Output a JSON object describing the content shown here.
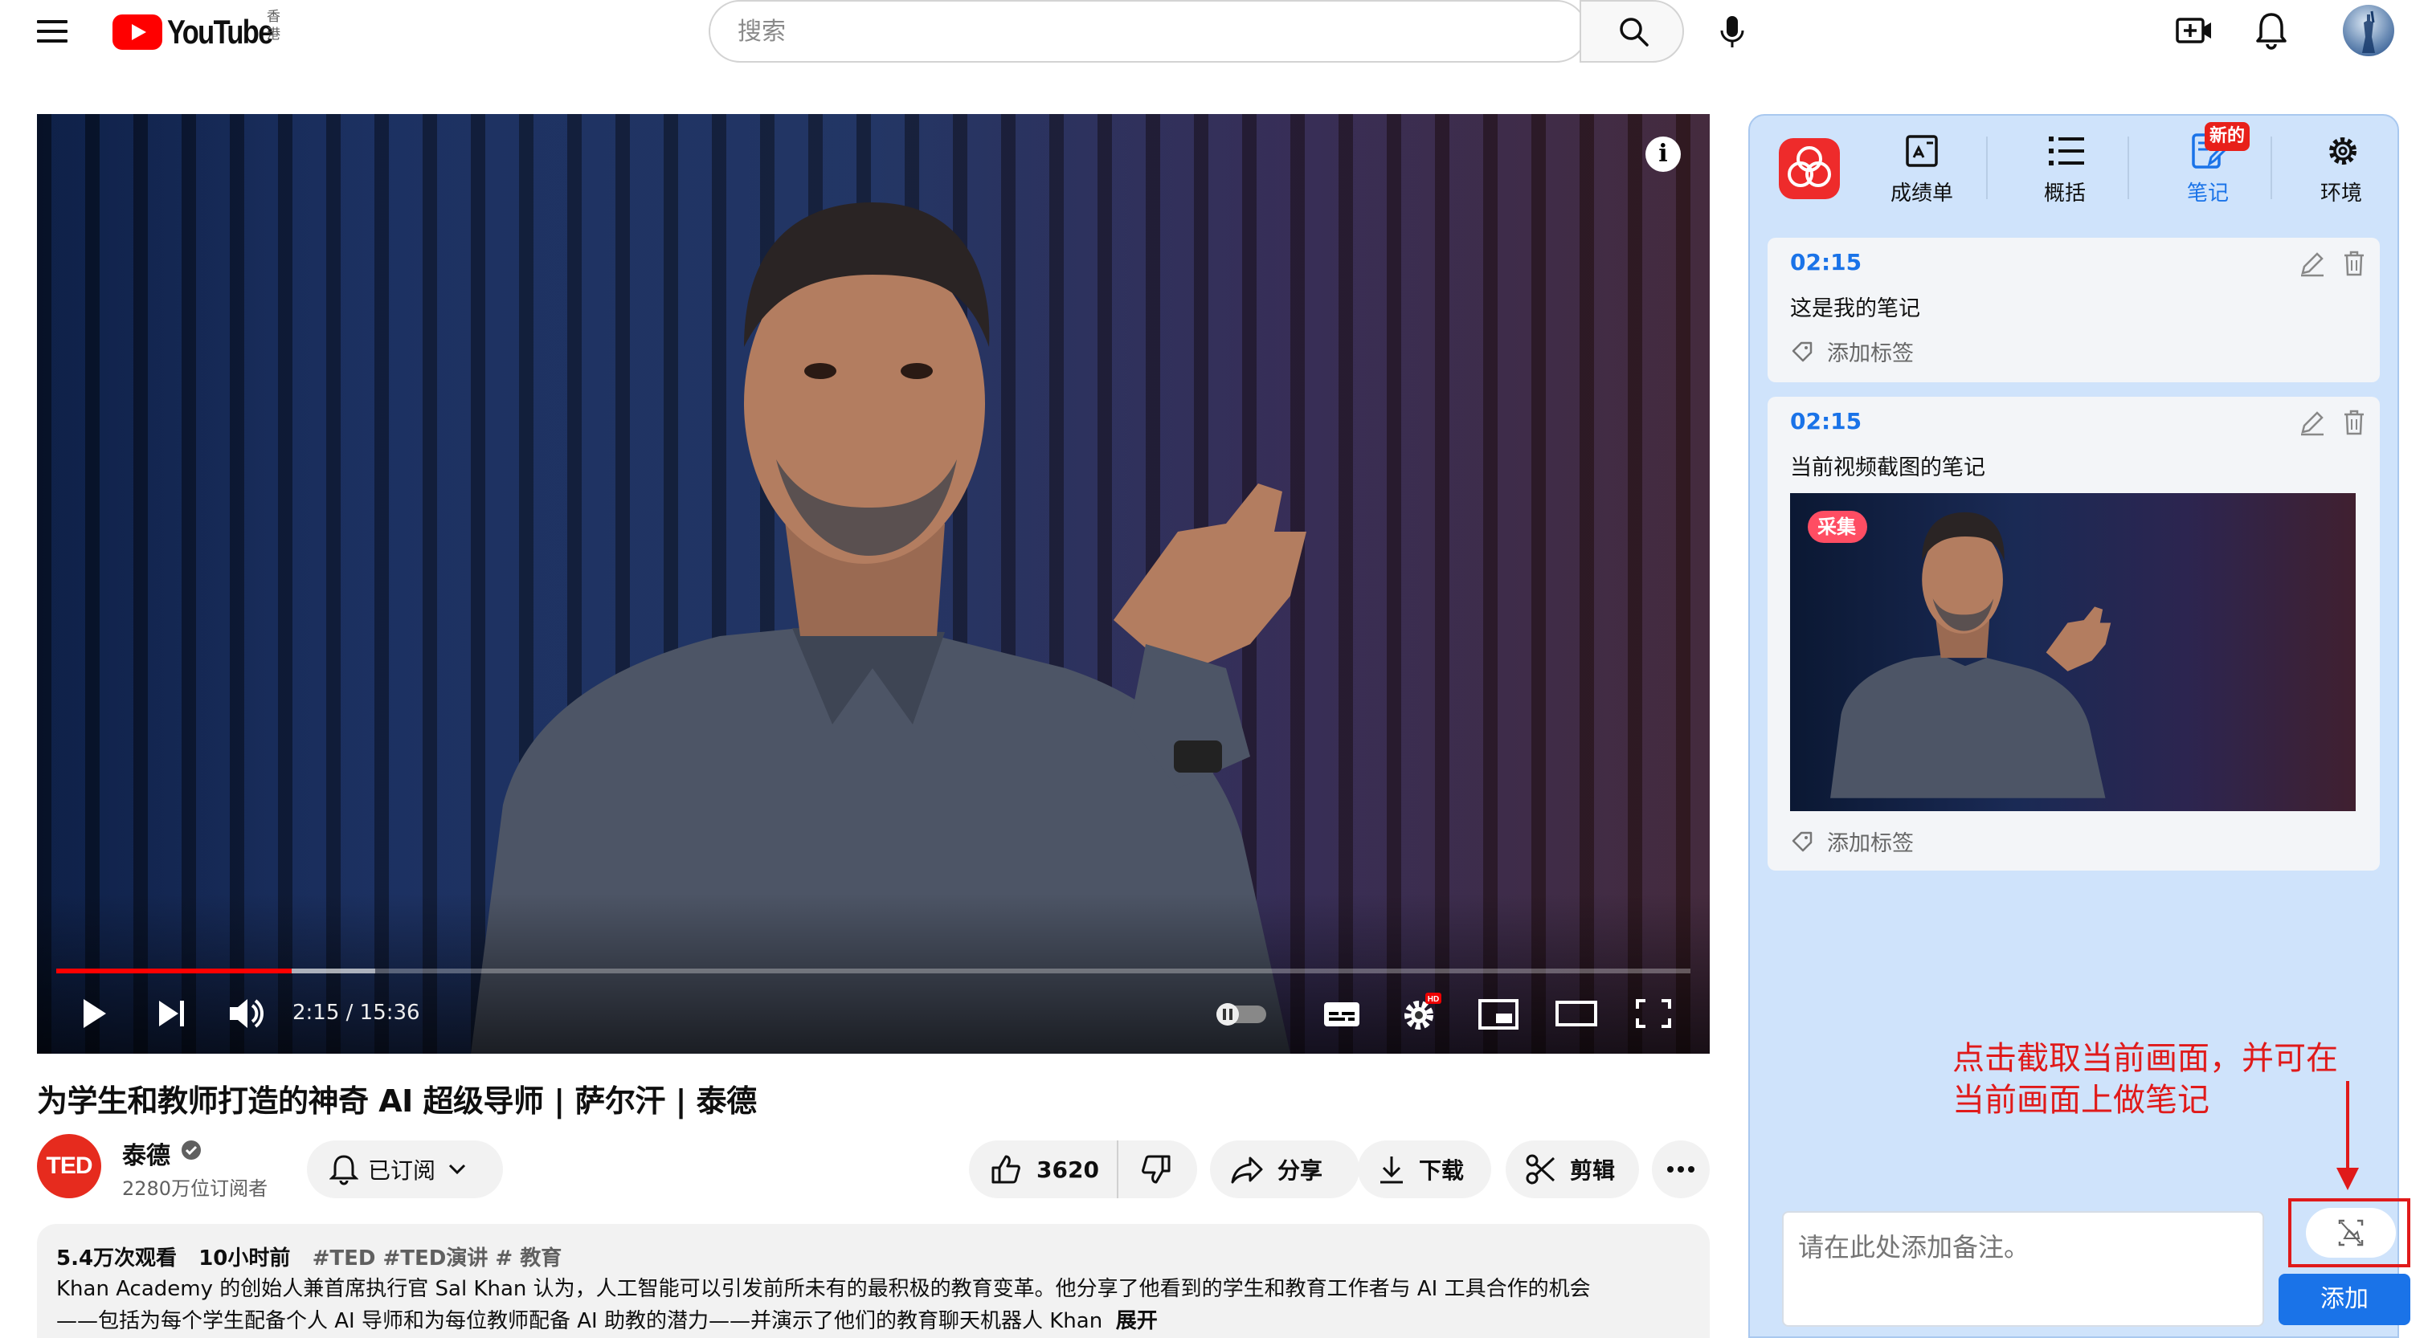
{
  "header": {
    "logo_text": "YouTube",
    "region": "香港",
    "search_placeholder": "搜索",
    "icons": [
      "menu-icon",
      "search-icon",
      "microphone-icon",
      "create-video-icon",
      "bell-icon",
      "avatar"
    ]
  },
  "player": {
    "current_time": "2:15",
    "duration": "15:36",
    "time_display": "2:15 / 15:36",
    "progress_fraction": 0.144,
    "buffered_fraction": 0.195,
    "quality_badge": "HD"
  },
  "video": {
    "title": "为学生和教师打造的神奇 AI 超级导师 | 萨尔汗 | 泰德",
    "channel_logo_text": "TED",
    "channel_name": "泰德",
    "subscribers": "2280万位订阅者",
    "subscribed_label": "已订阅",
    "like_count": "3620",
    "share_label": "分享",
    "download_label": "下载",
    "clip_label": "剪辑"
  },
  "description": {
    "views": "5.4万次观看",
    "age": "10小时前",
    "tags": "#TED #TED演讲 # 教育",
    "line1": "Khan Academy 的创始人兼首席执行官 Sal Khan 认为，人工智能可以引发前所未有的最积极的教育变革。他分享了他看到的学生和教育工作者与 AI 工具合作的机会",
    "line2": "——包括为每个学生配备个人 AI 导师和为每位教师配备 AI 助教的潜力——并演示了他们的教育聊天机器人 Khan",
    "more_label": "展开"
  },
  "panel": {
    "tabs": [
      {
        "label": "成绩单",
        "icon": "transcript-icon"
      },
      {
        "label": "概括",
        "icon": "summary-list-icon"
      },
      {
        "label": "笔记",
        "icon": "notes-icon"
      },
      {
        "label": "环境",
        "icon": "settings-gear-icon"
      }
    ],
    "active_tab": "笔记",
    "new_badge": "新的",
    "notes": [
      {
        "time": "02:15",
        "text": "这是我的笔记",
        "tag_label": "添加标签"
      },
      {
        "time": "02:15",
        "text": "当前视频截图的笔记",
        "tag_label": "添加标签",
        "collect_badge": "采集"
      }
    ],
    "annotation_line1": "点击截取当前画面，并可在",
    "annotation_line2": "当前画面上做笔记",
    "input_placeholder": "请在此处添加备注。",
    "add_label": "添加",
    "accent_color": "#1a73e8",
    "annotation_color": "#e01a1a"
  }
}
